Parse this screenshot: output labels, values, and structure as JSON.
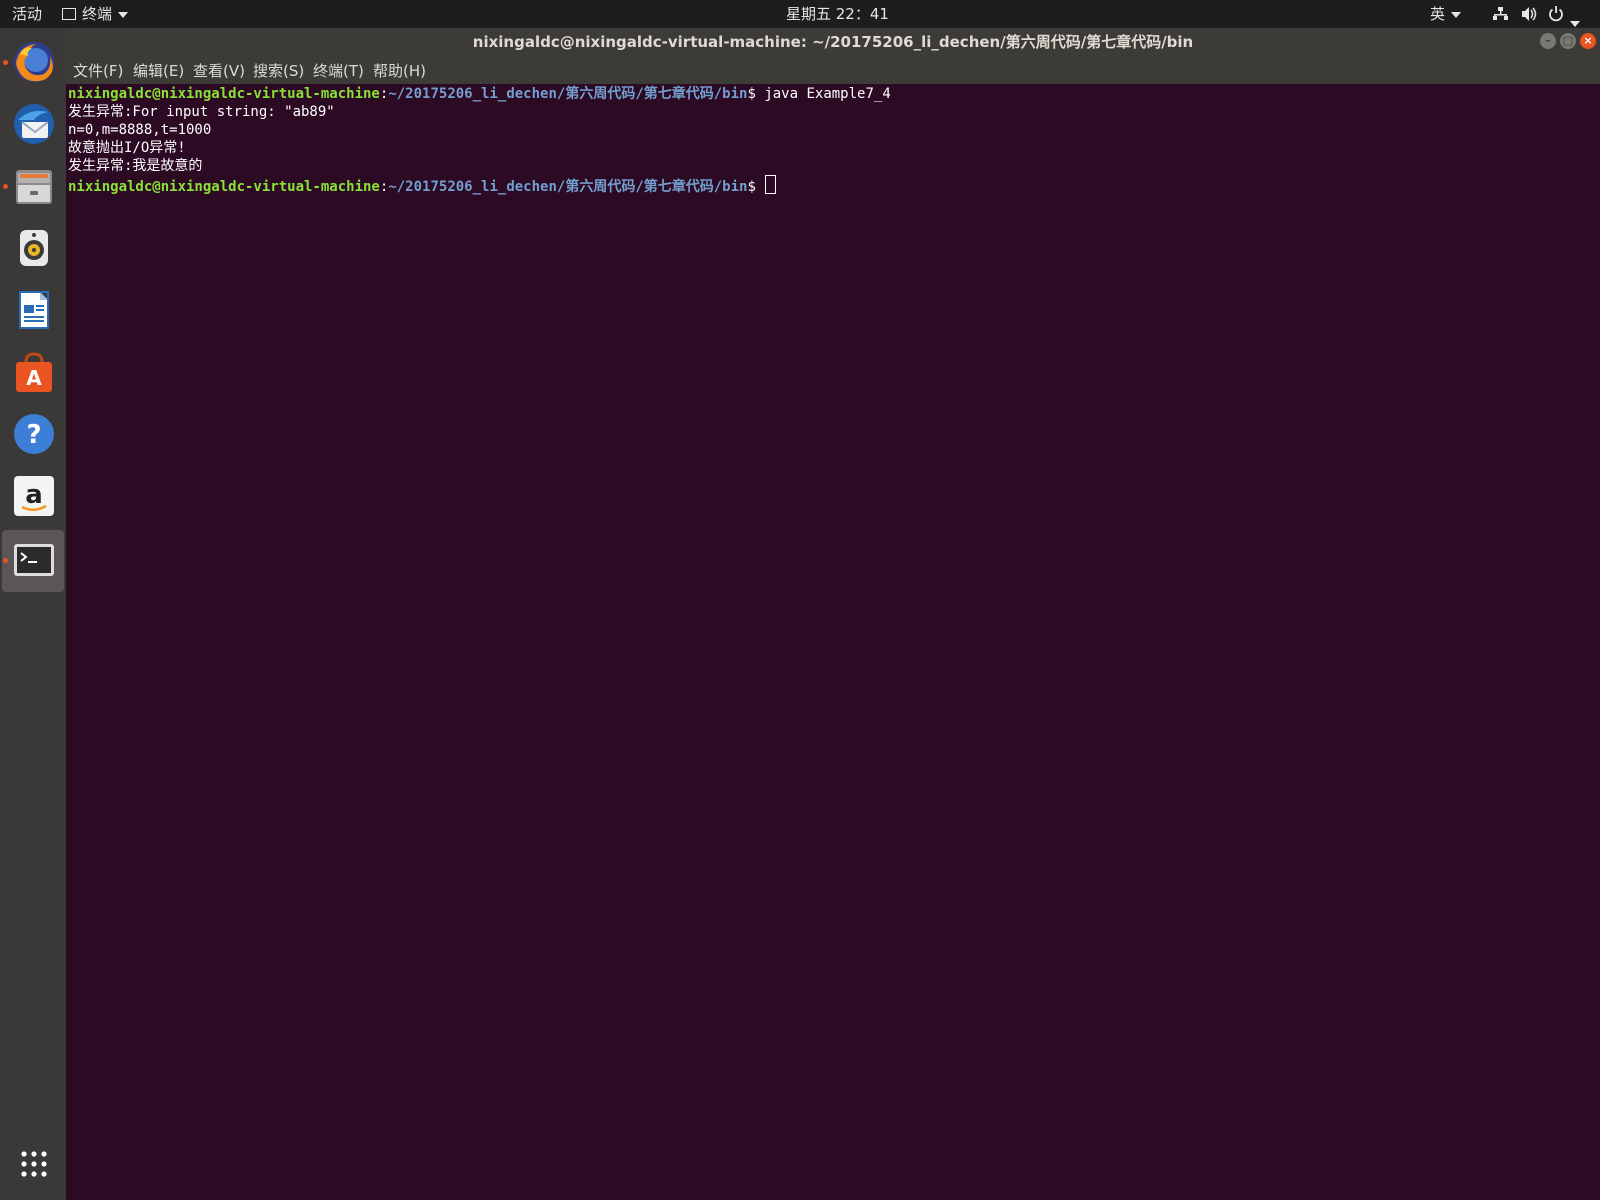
{
  "top_panel": {
    "activities": "活动",
    "app_menu_label": "终端",
    "clock": "星期五 22：41",
    "input_method": "英"
  },
  "dock": {
    "items": [
      {
        "name": "firefox-icon",
        "running": true
      },
      {
        "name": "thunderbird-icon",
        "running": false
      },
      {
        "name": "files-icon",
        "running": true
      },
      {
        "name": "rhythmbox-icon",
        "running": false
      },
      {
        "name": "libreoffice-writer-icon",
        "running": false
      },
      {
        "name": "software-center-icon",
        "running": false
      },
      {
        "name": "help-icon",
        "running": false
      },
      {
        "name": "amazon-icon",
        "running": false
      },
      {
        "name": "terminal-icon",
        "running": true,
        "active": true
      }
    ],
    "show_apps_icon": "apps-grid-icon"
  },
  "window": {
    "title": "nixingaldc@nixingaldc-virtual-machine: ~/20175206_li_dechen/第六周代码/第七章代码/bin",
    "menu": [
      "文件(F)",
      "编辑(E)",
      "查看(V)",
      "搜索(S)",
      "终端(T)",
      "帮助(H)"
    ]
  },
  "terminal": {
    "prompt_user": "nixingaldc@nixingaldc-virtual-machine",
    "prompt_sep": ":",
    "prompt_path": "~/20175206_li_dechen/第六周代码/第七章代码/bin",
    "prompt_symbol": "$ ",
    "command": "java Example7_4",
    "output": [
      "发生异常:For input string: \"ab89\"",
      "n=0,m=8888,t=1000",
      "故意抛出I/O异常!",
      "发生异常:我是故意的"
    ]
  },
  "colors": {
    "terminal_bg": "#2c0a23",
    "prompt_user": "#8ae234",
    "prompt_path": "#729fcf",
    "accent": "#e95420"
  }
}
